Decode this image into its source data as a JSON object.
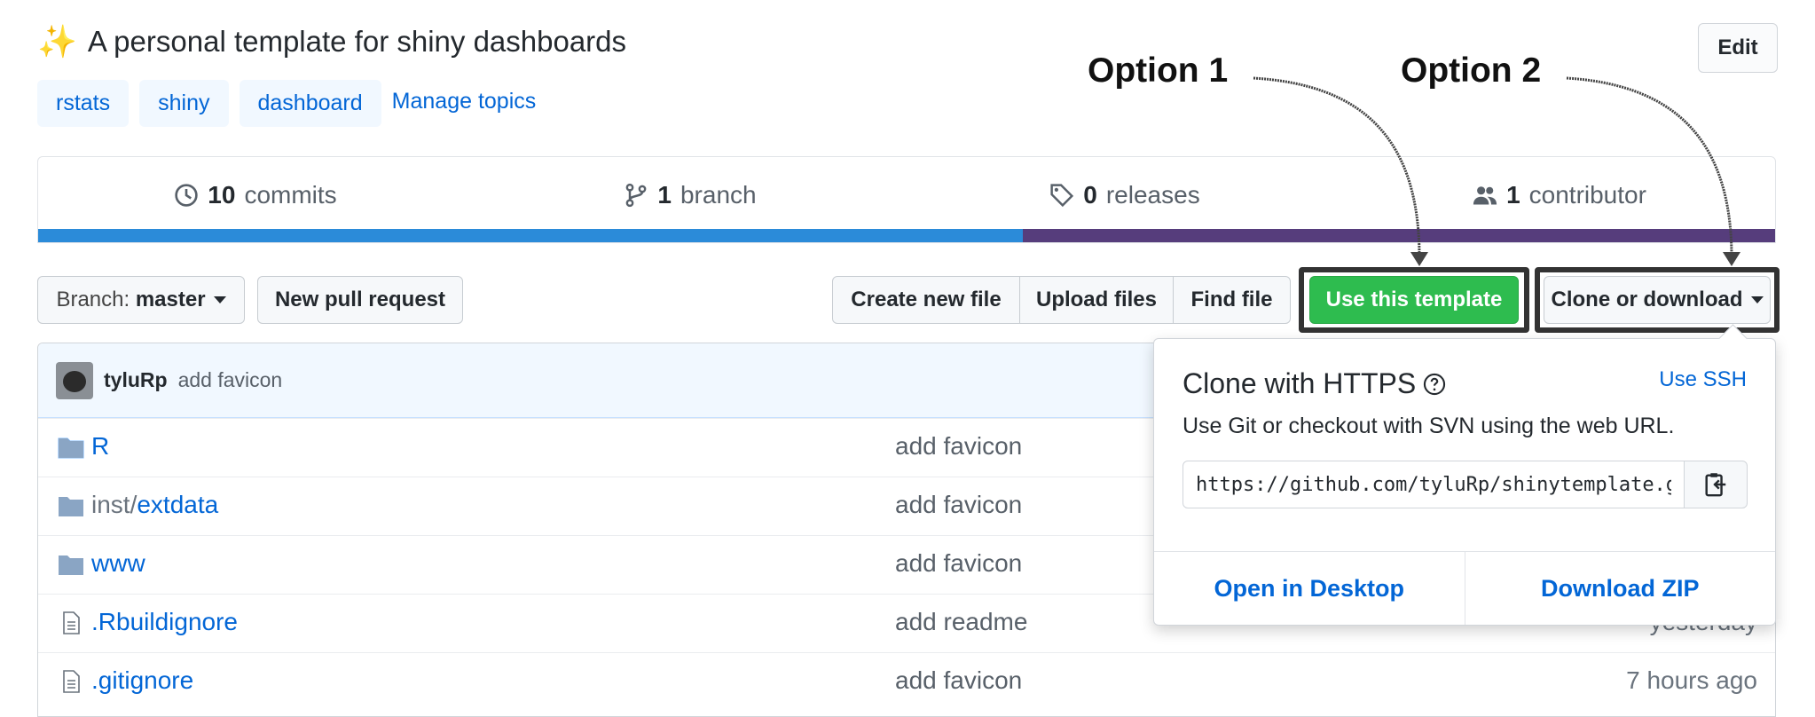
{
  "repo": {
    "description": "A personal template for shiny dashboards",
    "sparkle": "✨",
    "topics": [
      "rstats",
      "shiny",
      "dashboard"
    ],
    "manage_topics": "Manage topics",
    "edit": "Edit"
  },
  "annotations": {
    "option1": "Option 1",
    "option2": "Option 2"
  },
  "summary": {
    "commits_count": "10",
    "commits_label": "commits",
    "branch_count": "1",
    "branch_label": "branch",
    "releases_count": "0",
    "releases_label": "releases",
    "contributor_count": "1",
    "contributor_label": "contributor",
    "language_colors": [
      "#2b8bd9",
      "#563d7c"
    ],
    "language_fractions": [
      0.567,
      0.433
    ]
  },
  "toolbar": {
    "branch_prefix": "Branch:",
    "branch_name": "master",
    "new_pr": "New pull request",
    "create_file": "Create new file",
    "upload_files": "Upload files",
    "find_file": "Find file",
    "use_template": "Use this template",
    "clone_download": "Clone or download"
  },
  "latest_commit": {
    "author": "tyluRp",
    "message": "add favicon"
  },
  "files": [
    {
      "name": "R",
      "prefix": "",
      "type": "folder",
      "message": "add favicon",
      "age": ""
    },
    {
      "name": "extdata",
      "prefix": "inst/",
      "type": "folder",
      "message": "add favicon",
      "age": ""
    },
    {
      "name": "www",
      "prefix": "",
      "type": "folder",
      "message": "add favicon",
      "age": ""
    },
    {
      "name": ".Rbuildignore",
      "prefix": "",
      "type": "file",
      "message": "add readme",
      "age": "yesterday"
    },
    {
      "name": ".gitignore",
      "prefix": "",
      "type": "file",
      "message": "add favicon",
      "age": "7 hours ago"
    }
  ],
  "clone_popup": {
    "title": "Clone with HTTPS",
    "use_ssh": "Use SSH",
    "description": "Use Git or checkout with SVN using the web URL.",
    "url": "https://github.com/tyluRp/shinytemplate.git",
    "open_desktop": "Open in Desktop",
    "download_zip": "Download ZIP"
  },
  "colors": {
    "link": "#0366d6",
    "green_button": "#2ebc4f"
  }
}
